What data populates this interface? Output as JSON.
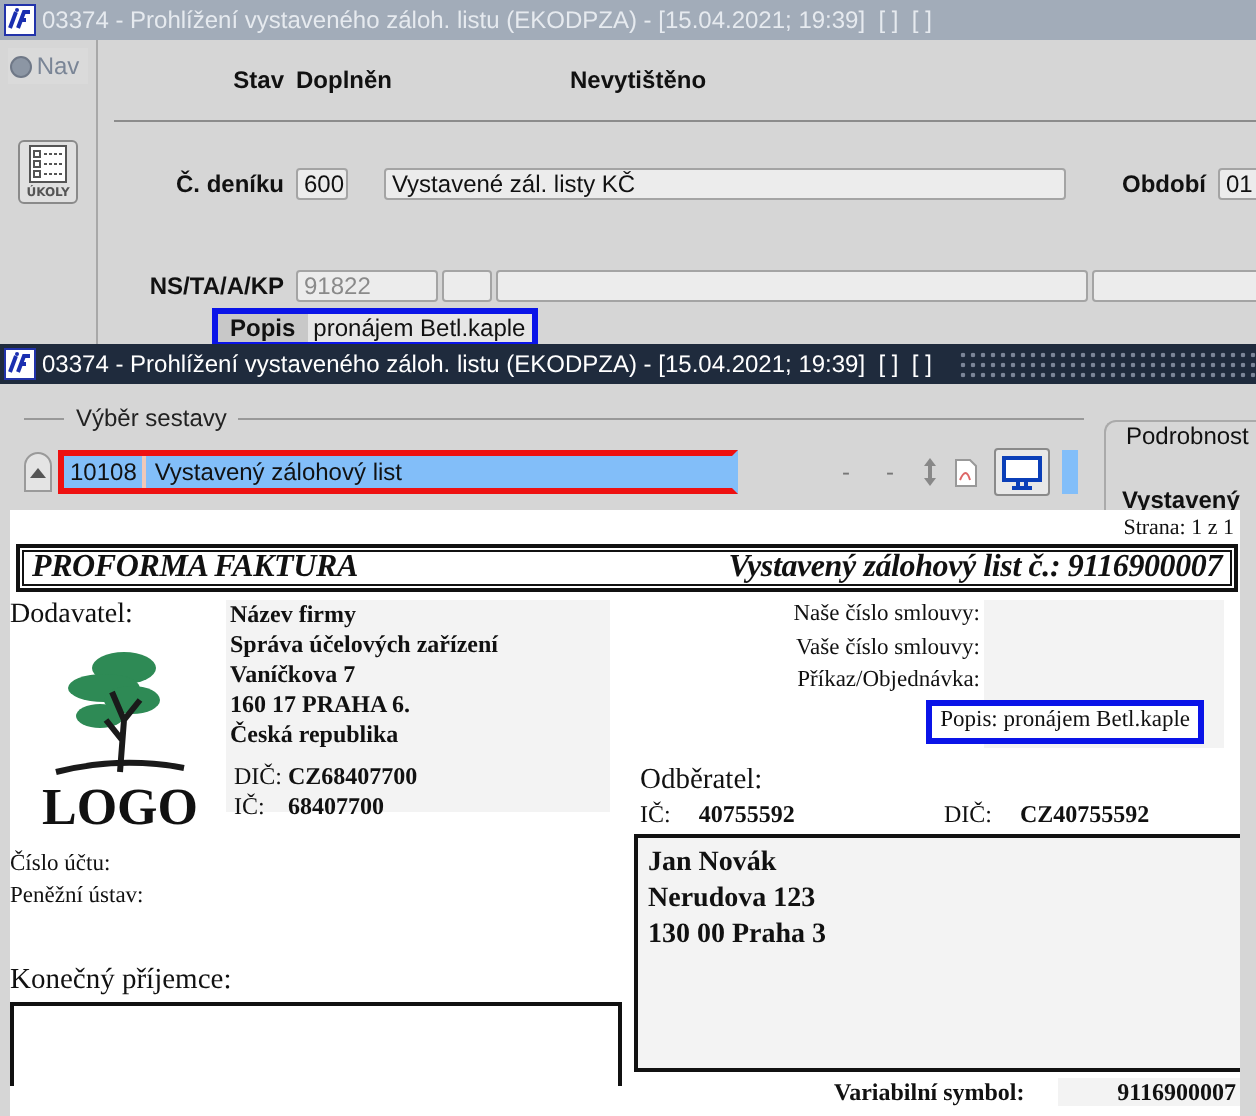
{
  "back_window": {
    "title": "03374 - Prohlížení vystaveného záloh. listu (EKODPZA) - [15.04.2021; 19:39]  [ ]  [ ]",
    "nav": {
      "label": "Nav"
    },
    "tasks_button": {
      "label": "ÚKOLY"
    },
    "status": {
      "label": "Stav",
      "values": [
        "Doplněn",
        "Nevytištěno"
      ]
    },
    "journal": {
      "label": "Č. deníku",
      "number": "600",
      "name": "Vystavené zál. listy KČ"
    },
    "period": {
      "label": "Období",
      "value": "01"
    },
    "cost_center": {
      "label": "NS/TA/A/KP",
      "value": "91822",
      "disabled": true
    },
    "description": {
      "label": "Popis",
      "value": "pronájem Betl.kaple",
      "highlighted": true
    }
  },
  "front_window": {
    "title": "03374 - Prohlížení vystaveného záloh. listu (EKODPZA) - [15.04.2021; 19:39]  [ ]  [ ]",
    "report_selection": {
      "legend": "Výběr sestavy",
      "rows": [
        {
          "code": "10108",
          "name": "Vystavený zálohový list",
          "selected": true,
          "highlighted": true,
          "marks": [
            "-",
            "-"
          ]
        }
      ]
    },
    "details": {
      "legend": "Podrobnost",
      "heading": "Vystavený"
    }
  },
  "document": {
    "page": "Strana: 1 z 1",
    "heading": "PROFORMA FAKTURA",
    "doc_title": "Vystavený zálohový list č.: 9116900007",
    "supplier_label": "Dodavatel:",
    "logo_text": "LOGO",
    "supplier_lines": [
      "Název firmy",
      "Správa účelových zařízení",
      "Vaníčkova 7",
      "160 17 PRAHA 6.",
      "Česká republika"
    ],
    "supplier_ids": [
      {
        "label": "DIČ:",
        "value": "CZ68407700"
      },
      {
        "label": "IČ:",
        "value": "68407700"
      }
    ],
    "bank_labels": [
      "Číslo účtu:",
      "Peněžní ústav:"
    ],
    "final_recipient_label": "Konečný příjemce:",
    "references": [
      "Naše číslo smlouvy:",
      "Vaše číslo smlouvy:",
      "Příkaz/Objednávka:"
    ],
    "description": {
      "text": "Popis: pronájem Betl.kaple",
      "highlighted": true
    },
    "customer_label": "Odběratel:",
    "customer_ids": [
      {
        "label": "IČ:",
        "value": "40755592"
      },
      {
        "label": "DIČ:",
        "value": "CZ40755592"
      }
    ],
    "customer_lines": [
      "Jan Novák",
      "Nerudova 123",
      "130 00 Praha 3"
    ],
    "variable_symbol": {
      "label": "Variabilní symbol:",
      "value": "9116900007"
    }
  }
}
